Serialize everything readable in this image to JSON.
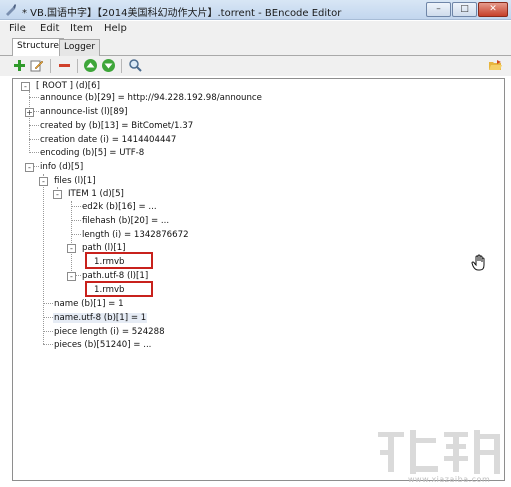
{
  "window": {
    "title": "* VB.国语中字】【2014美国科幻动作大片】.torrent - BEncode Editor",
    "min_label": "–",
    "max_label": "□",
    "close_label": "✕"
  },
  "menu": [
    "File",
    "Edit",
    "Item",
    "Help"
  ],
  "tabs": [
    {
      "label": "Structure",
      "active": true
    },
    {
      "label": "Logger",
      "active": false
    }
  ],
  "toolbar": {
    "icons": [
      "add-icon",
      "edit-icon",
      "remove-icon",
      "move-up-icon",
      "move-down-icon",
      "search-icon",
      "open-folder-icon"
    ]
  },
  "tree": [
    {
      "label": "[ ROOT ] (d)[6]",
      "expander": "-"
    },
    {
      "label": "announce (b)[29] = http://94.228.192.98/announce",
      "expander": ""
    },
    {
      "label": "announce-list (l)[89]",
      "expander": "+"
    },
    {
      "label": "created by (b)[13] = BitComet/1.37",
      "expander": ""
    },
    {
      "label": "creation date (i) = 1414404447",
      "expander": ""
    },
    {
      "label": "encoding (b)[5] = UTF-8",
      "expander": ""
    },
    {
      "label": "info (d)[5]",
      "expander": "-"
    },
    {
      "label": "files (l)[1]",
      "expander": "-"
    },
    {
      "label": "ITEM 1 (d)[5]",
      "expander": "-"
    },
    {
      "label": "ed2k (b)[16] = ...",
      "expander": ""
    },
    {
      "label": "filehash (b)[20] = ...",
      "expander": ""
    },
    {
      "label": "length (i) = 1342876672",
      "expander": ""
    },
    {
      "label": "path (l)[1]",
      "expander": "-"
    },
    {
      "label": "1.rmvb",
      "expander": ""
    },
    {
      "label": "path.utf-8 (l)[1]",
      "expander": "-"
    },
    {
      "label": "1.rmvb",
      "expander": ""
    },
    {
      "label": "name (b)[1] = 1",
      "expander": ""
    },
    {
      "label": "name.utf-8 (b)[1] = 1",
      "expander": "",
      "selected": true
    },
    {
      "label": "piece length (i) = 524288",
      "expander": ""
    },
    {
      "label": "pieces (b)[51240] = ...",
      "expander": ""
    }
  ],
  "watermark": {
    "text": "www.xiazaiba.com"
  },
  "colors": {
    "highlight_box": "#c8211c",
    "titlebar": "#c2d6ee"
  }
}
